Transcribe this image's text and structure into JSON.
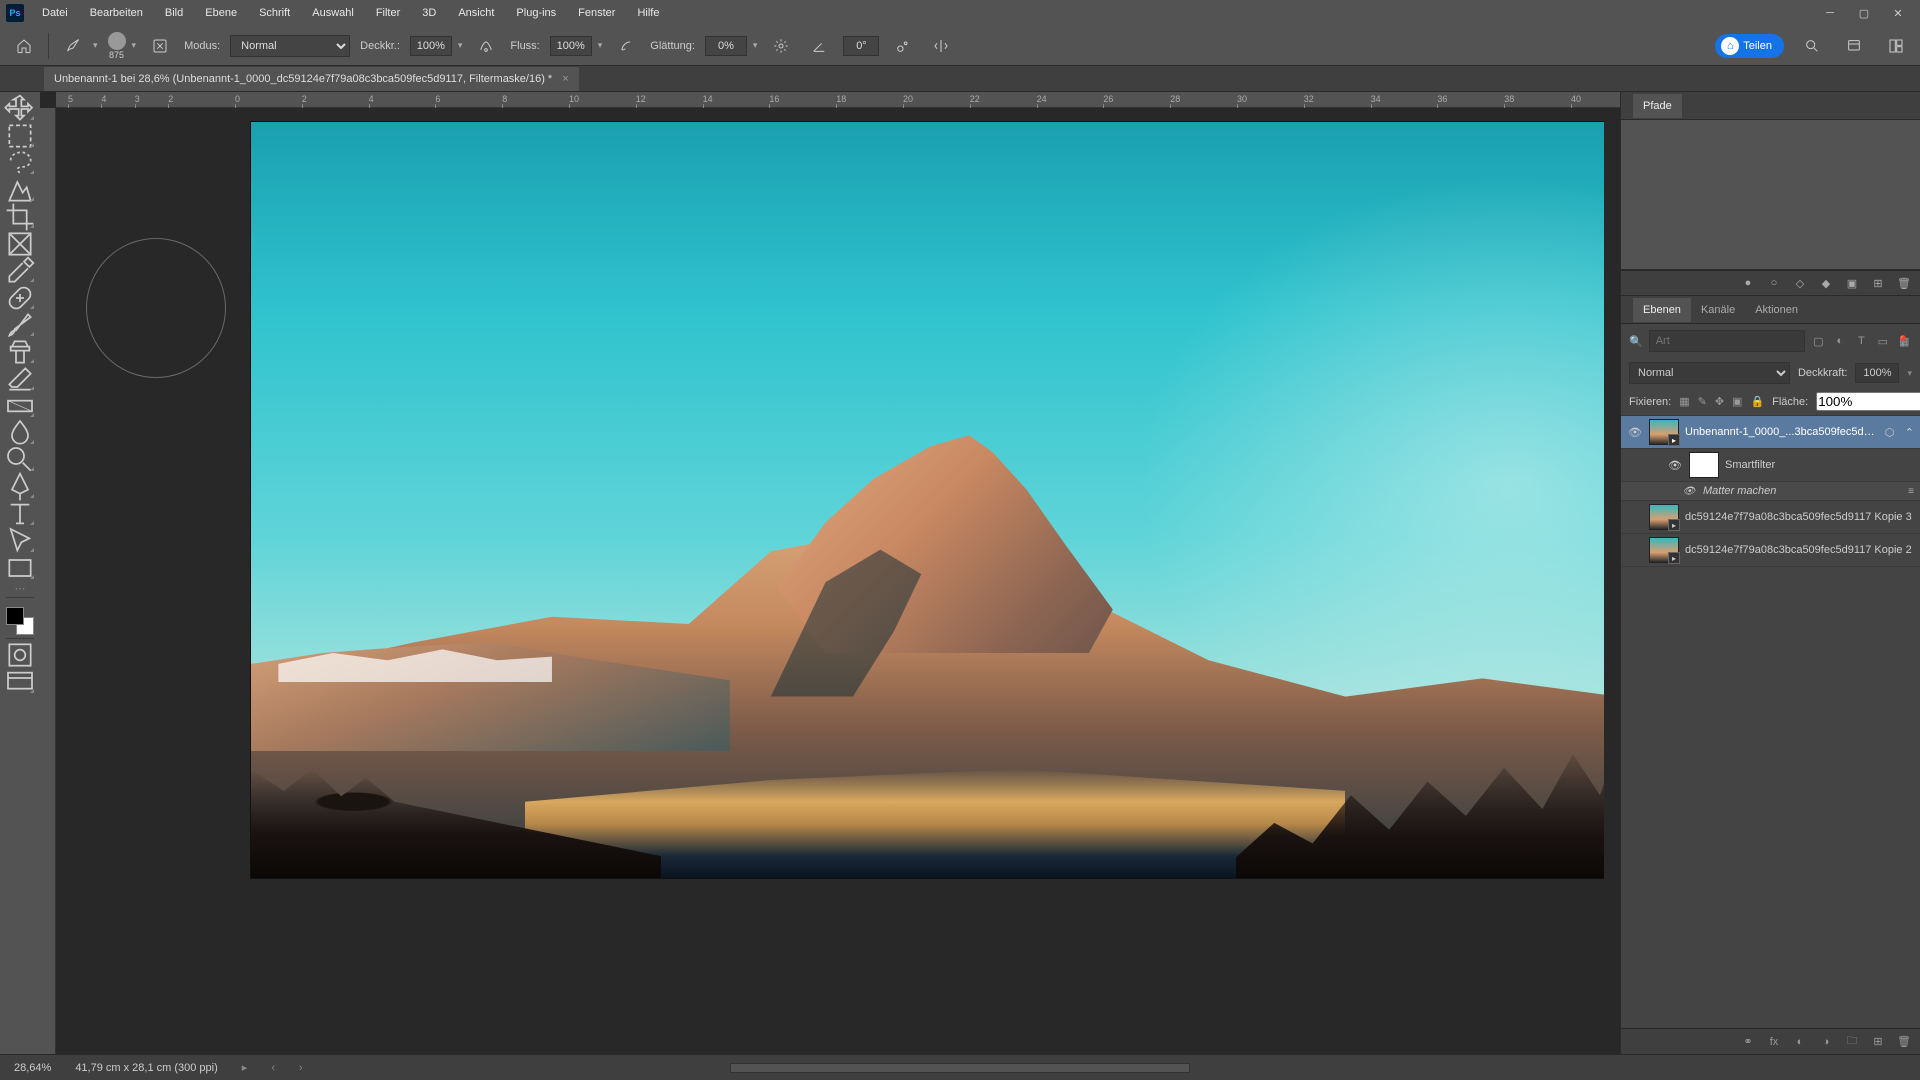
{
  "menu": {
    "items": [
      "Datei",
      "Bearbeiten",
      "Bild",
      "Ebene",
      "Schrift",
      "Auswahl",
      "Filter",
      "3D",
      "Ansicht",
      "Plug-ins",
      "Fenster",
      "Hilfe"
    ]
  },
  "options": {
    "brush_size": "875",
    "modus_label": "Modus:",
    "modus_value": "Normal",
    "deckkr_label": "Deckkr.:",
    "deckkr_value": "100%",
    "fluss_label": "Fluss:",
    "fluss_value": "100%",
    "glattung_label": "Glättung:",
    "glattung_value": "0%",
    "angle_value": "0°",
    "share_label": "Teilen"
  },
  "tab": {
    "title": "Unbenannt-1 bei 28,6% (Unbenannt-1_0000_dc59124e7f79a08c3bca509fec5d9117, Filtermaske/16) *"
  },
  "ruler": {
    "ticks": [
      "0",
      "2",
      "4",
      "6",
      "8",
      "10",
      "12",
      "14",
      "16",
      "18",
      "20",
      "22",
      "24",
      "26",
      "28",
      "30",
      "32",
      "34",
      "36",
      "38",
      "40"
    ]
  },
  "panels": {
    "pfade": "Pfade",
    "ebenen": "Ebenen",
    "kanale": "Kanäle",
    "aktionen": "Aktionen"
  },
  "layers_panel": {
    "search_placeholder": "Art",
    "blend_mode": "Normal",
    "deckkraft_label": "Deckkraft:",
    "deckkraft_value": "100%",
    "fixieren_label": "Fixieren:",
    "flache_label": "Fläche:",
    "flache_value": "100%",
    "layers": [
      {
        "name": "Unbenannt-1_0000_...3bca509fec5d9117",
        "visible": true,
        "selected": true,
        "linked": true
      },
      {
        "name": "Smartfilter",
        "sub": true,
        "visible": true
      },
      {
        "name": "Matter machen",
        "subsub": true
      },
      {
        "name": "dc59124e7f79a08c3bca509fec5d9117 Kopie 3",
        "visible": false
      },
      {
        "name": "dc59124e7f79a08c3bca509fec5d9117 Kopie 2",
        "visible": false
      }
    ]
  },
  "status": {
    "zoom": "28,64%",
    "info": "41,79 cm x 28,1 cm (300 ppi)"
  }
}
